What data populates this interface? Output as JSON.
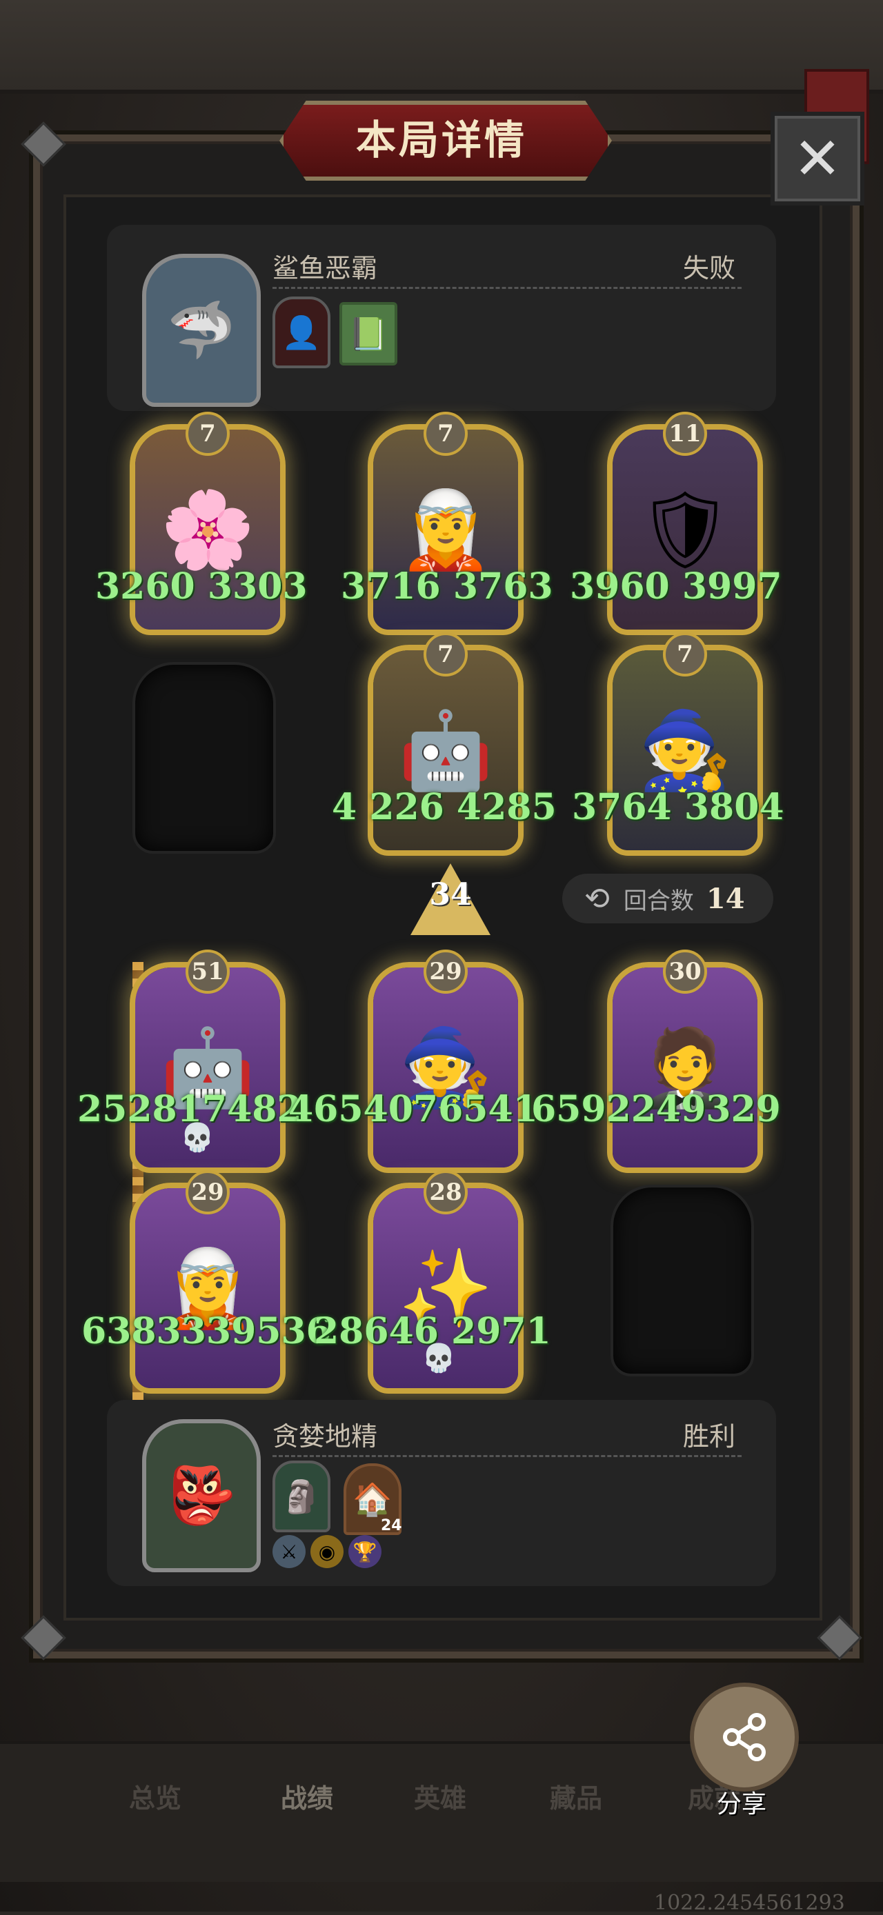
{
  "title": "本局详情",
  "close_icon": "close-icon",
  "opponent": {
    "name": "鲨鱼恶霸",
    "result": "失败",
    "portrait_icon": "shark-portrait",
    "items": [
      "dark-figure-icon",
      "green-book-icon"
    ]
  },
  "player": {
    "name": "贪婪地精",
    "result": "胜利",
    "portrait_icon": "goblin-portrait",
    "items": [
      "goblin-statue-icon",
      "house-icon"
    ],
    "house_badge": "24",
    "buffs": [
      "sword-buff-icon",
      "gold-buff-icon",
      "trophy-buff-icon"
    ]
  },
  "opponent_cards": [
    {
      "level": "7",
      "stats": "3260 3303",
      "icon": "flower-girl"
    },
    {
      "level": "7",
      "stats": "3716  3763",
      "icon": "elf-woman"
    },
    {
      "level": "11",
      "stats": "3960 3997",
      "icon": "shield-knight"
    },
    {
      "level": "7",
      "stats": "4 226 4285",
      "icon": "diver-robot"
    },
    {
      "level": "7",
      "stats": "3764 3804",
      "icon": "wizard-girl"
    }
  ],
  "player_cards": [
    {
      "level": "51",
      "stats": "252817482",
      "icon": "diver-robot"
    },
    {
      "level": "29",
      "stats": "4654076541",
      "icon": "wizard-girl"
    },
    {
      "level": "30",
      "stats": "6592249329",
      "icon": "butler-chef"
    },
    {
      "level": "29",
      "stats": "6383339536",
      "icon": "elf-woman"
    },
    {
      "level": "28",
      "stats": "28646 2971",
      "icon": "star-mage"
    }
  ],
  "arrow_badge": "34",
  "round": {
    "label": "回合数",
    "value": "14"
  },
  "tabs": [
    "总览",
    "战绩",
    "英雄",
    "藏品",
    "成就"
  ],
  "share_label": "分享",
  "footer_code": "1022.2454561293",
  "colors": {
    "stat_green": "#9cf08c",
    "card_gold": "#c9a43c",
    "title_red": "#7a1c1c"
  }
}
